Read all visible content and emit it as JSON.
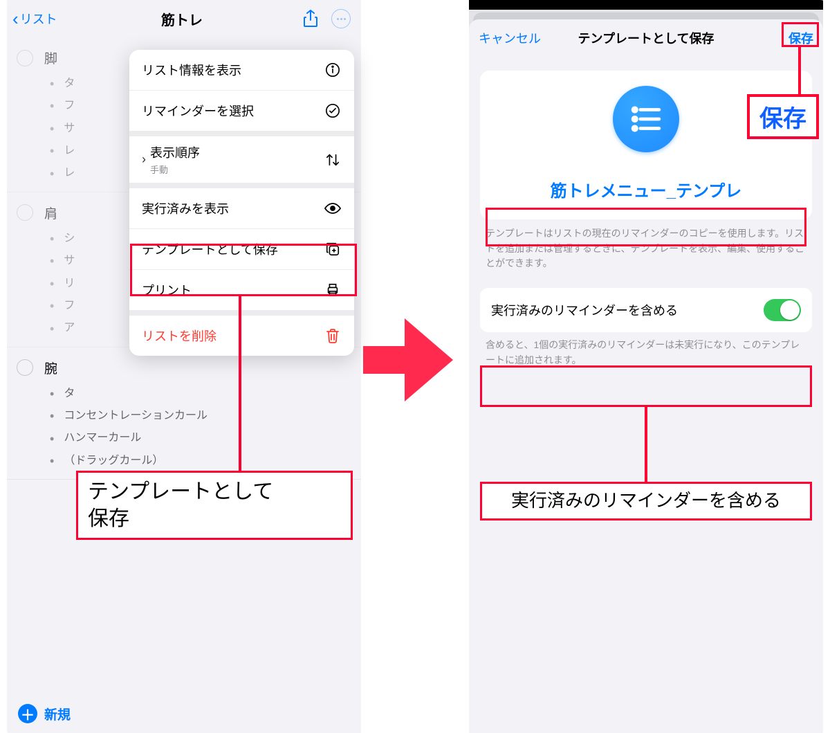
{
  "left": {
    "back_label": "リスト",
    "title": "筋トレ",
    "toolbar_new": "新規",
    "sections": [
      {
        "title": "脚",
        "items": [
          "タ",
          "フ",
          "サ",
          "レ",
          "レ"
        ]
      },
      {
        "title": "肩",
        "items": [
          "シ",
          "サ",
          "リ",
          "フ",
          "ア"
        ]
      },
      {
        "title": "腕",
        "items": [
          "タ",
          "コンセントレーションカール",
          "ハンマーカール",
          "（ドラッグカール）"
        ]
      }
    ],
    "menu": {
      "show_list_info": "リスト情報を表示",
      "select_reminders": "リマインダーを選択",
      "sort_label": "表示順序",
      "sort_value": "手動",
      "show_completed": "実行済みを表示",
      "save_template": "テンプレートとして保存",
      "print": "プリント",
      "delete_list": "リストを削除"
    },
    "annotation_save_template": "テンプレートとして\n保存"
  },
  "right": {
    "cancel": "キャンセル",
    "title": "テンプレートとして保存",
    "save": "保存",
    "template_name": "筋トレメニュー_テンプレ",
    "desc": "テンプレートはリストの現在のリマインダーのコピーを使用します。リストを追加または管理するときに、テンプレートを表示、編集、使用することができます。",
    "include_completed": "実行済みのリマインダーを含める",
    "include_completed_desc": "含めると、1個の実行済みのリマインダーは未実行になり、このテンプレートに追加されます。",
    "anno_save": "保存",
    "anno_include": "実行済みのリマインダーを含める"
  }
}
